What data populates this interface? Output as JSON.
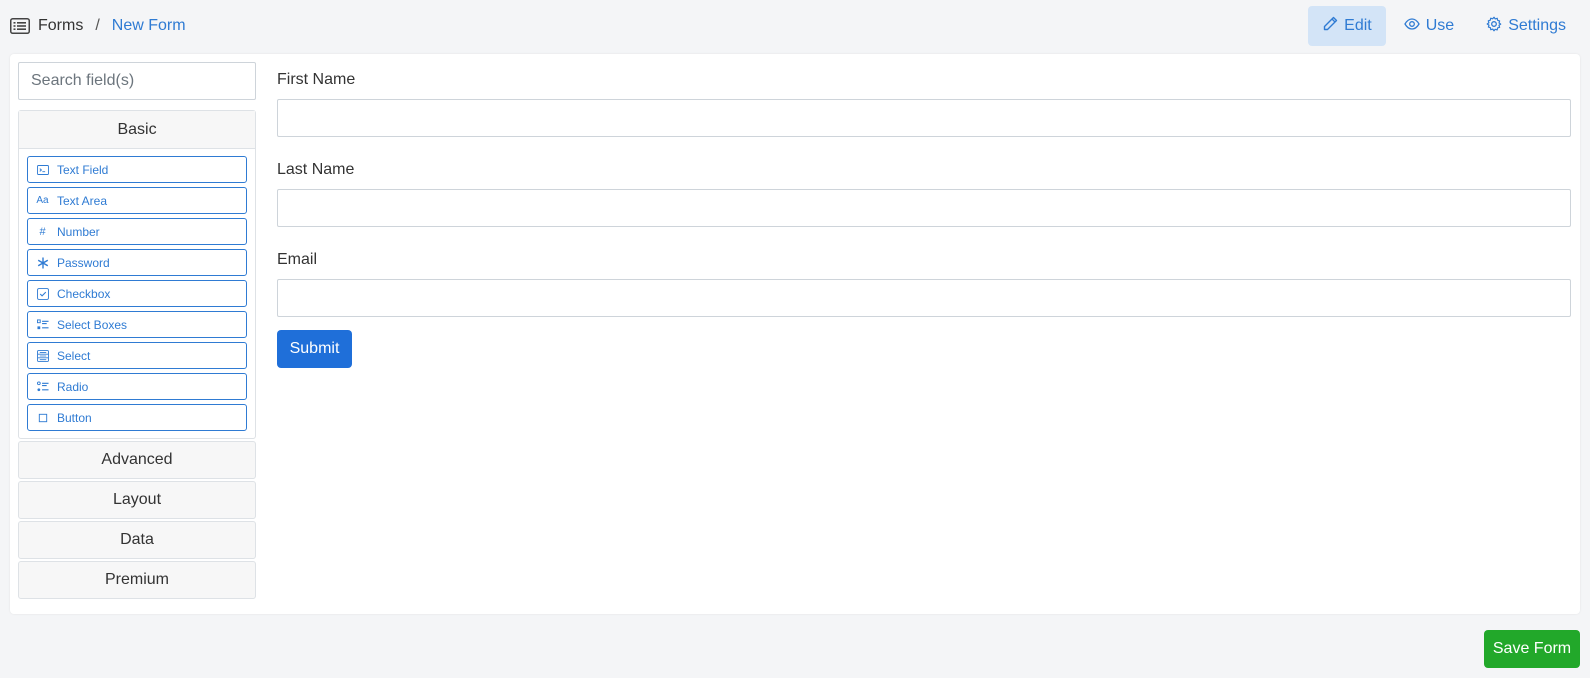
{
  "breadcrumb": {
    "icon": "list-icon",
    "root": "Forms",
    "separator": "/",
    "current": "New Form"
  },
  "top_actions": {
    "edit": {
      "label": "Edit",
      "icon": "pencil-icon",
      "active": true
    },
    "use": {
      "label": "Use",
      "icon": "eye-icon"
    },
    "settings": {
      "label": "Settings",
      "icon": "gear-icon"
    }
  },
  "sidebar": {
    "search_placeholder": "Search field(s)",
    "basic_group": {
      "title": "Basic",
      "items": [
        {
          "label": "Text Field",
          "icon": "terminal-icon"
        },
        {
          "label": "Text Area",
          "icon": "font-icon"
        },
        {
          "label": "Number",
          "icon": "hash-icon"
        },
        {
          "label": "Password",
          "icon": "asterisk-icon"
        },
        {
          "label": "Checkbox",
          "icon": "check-square-icon"
        },
        {
          "label": "Select Boxes",
          "icon": "list-ul-icon"
        },
        {
          "label": "Select",
          "icon": "th-list-icon"
        },
        {
          "label": "Radio",
          "icon": "dot-circle-icon"
        },
        {
          "label": "Button",
          "icon": "stop-icon"
        }
      ]
    },
    "other_groups": [
      "Advanced",
      "Layout",
      "Data",
      "Premium"
    ]
  },
  "form": {
    "fields": [
      {
        "label": "First Name",
        "value": ""
      },
      {
        "label": "Last Name",
        "value": ""
      },
      {
        "label": "Email",
        "value": ""
      }
    ],
    "submit_label": "Submit"
  },
  "footer": {
    "save_label": "Save Form"
  },
  "colors": {
    "accent": "#2f7bd3",
    "primary_button": "#1f6fd9",
    "save_button": "#22a82a",
    "active_tab_bg": "#d3e4f7"
  }
}
